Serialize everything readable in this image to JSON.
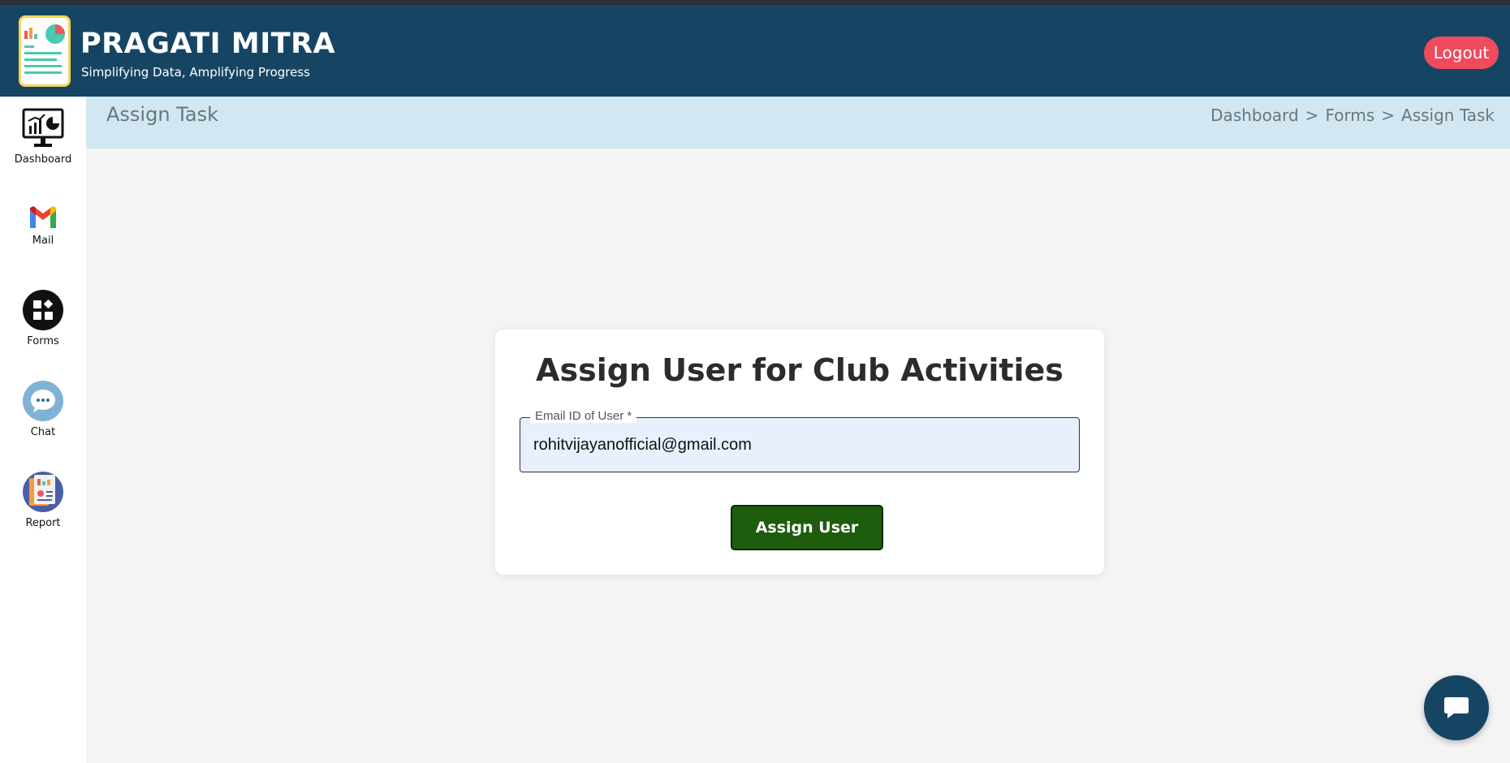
{
  "header": {
    "app_title": "PRAGATI MITRA",
    "app_subtitle": "Simplifying Data, Amplifying Progress",
    "logout_label": "Logout",
    "colors": {
      "header_bg": "#164563",
      "logout_bg": "#ef4b5c"
    }
  },
  "sidebar": {
    "items": [
      {
        "label": "Dashboard",
        "icon": "dashboard-monitor-icon"
      },
      {
        "label": "Mail",
        "icon": "gmail-icon"
      },
      {
        "label": "Forms",
        "icon": "forms-grid-icon"
      },
      {
        "label": "Chat",
        "icon": "chat-bubble-icon"
      },
      {
        "label": "Report",
        "icon": "report-icon"
      }
    ]
  },
  "banner": {
    "title": "Assign Task",
    "breadcrumb": [
      "Dashboard",
      ">",
      "Forms",
      ">",
      "Assign Task"
    ]
  },
  "form": {
    "title": "Assign User for Club Activities",
    "email_label": "Email ID of User *",
    "email_value": "rohitvijayanofficial@gmail.com",
    "submit_label": "Assign User",
    "colors": {
      "submit_bg": "#1e5c0e",
      "field_bg": "#e8f0fe"
    }
  },
  "chat_fab": {
    "icon": "chat-bubble-icon"
  }
}
